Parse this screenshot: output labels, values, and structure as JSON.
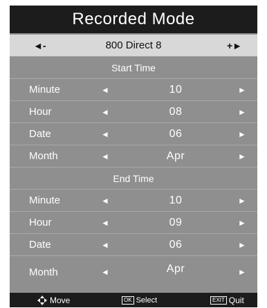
{
  "title": "Recorded Mode",
  "channel": {
    "prev_label": "◄-",
    "name": "800 Direct 8",
    "next_label": "+►"
  },
  "start_section": "Start Time",
  "start_fields": [
    {
      "label": "Minute",
      "value": "10"
    },
    {
      "label": "Hour",
      "value": "08"
    },
    {
      "label": "Date",
      "value": "06"
    },
    {
      "label": "Month",
      "value": "Apr"
    }
  ],
  "end_section": "End Time",
  "end_fields": [
    {
      "label": "Minute",
      "value": "10"
    },
    {
      "label": "Hour",
      "value": "09"
    },
    {
      "label": "Date",
      "value": "06"
    },
    {
      "label": "Month",
      "value": "Apr"
    }
  ],
  "arrows": {
    "left": "◄",
    "right": "►"
  },
  "footer": {
    "move_label": "Move",
    "ok_key": "OK",
    "select_label": "Select",
    "exit_key": "EXIT",
    "quit_label": "Quit"
  },
  "colors": {
    "panel": "#8f8f8f",
    "title_bar": "#1c1c1c",
    "channel_bar": "#d8d8d8",
    "text": "#ffffff"
  }
}
